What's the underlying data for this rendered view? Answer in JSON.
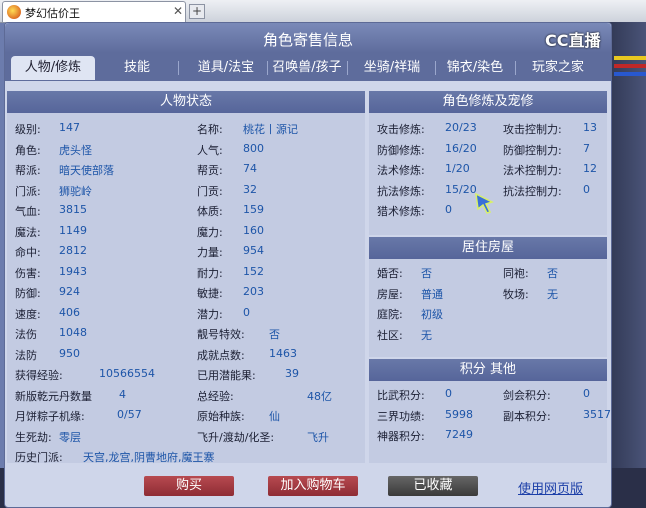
{
  "browser": {
    "tab_title": "梦幻估价王",
    "close_glyph": "✕",
    "new_tab_glyph": "+"
  },
  "panel": {
    "title": "角色寄售信息",
    "logo": "CC直播"
  },
  "tabs": [
    {
      "label": "人物/修炼"
    },
    {
      "label": "技能"
    },
    {
      "label": "道具/法宝"
    },
    {
      "label": "召唤兽/孩子"
    },
    {
      "label": "坐骑/祥瑞"
    },
    {
      "label": "锦衣/染色"
    },
    {
      "label": "玩家之家"
    }
  ],
  "status": {
    "title": "人物状态",
    "left": [
      {
        "label": "级别:",
        "value": "147"
      },
      {
        "label": "角色:",
        "value": "虎头怪"
      },
      {
        "label": "帮派:",
        "value": "暗天使部落"
      },
      {
        "label": "门派:",
        "value": "狮驼岭"
      },
      {
        "label": "气血:",
        "value": "3815"
      },
      {
        "label": "魔法:",
        "value": "1149"
      },
      {
        "label": "命中:",
        "value": "2812"
      },
      {
        "label": "伤害:",
        "value": "1943"
      },
      {
        "label": "防御:",
        "value": "924"
      },
      {
        "label": "速度:",
        "value": "406"
      },
      {
        "label": "法伤",
        "value": "1048"
      },
      {
        "label": "法防",
        "value": "950"
      },
      {
        "label": "获得经验:",
        "value": "10566554"
      },
      {
        "label": "新版乾元丹数量",
        "value": "4"
      },
      {
        "label": "月饼粽子机缘:",
        "value": "0/57"
      },
      {
        "label": "生死劫:",
        "value": "零层"
      }
    ],
    "right": [
      {
        "label": "名称:",
        "value": "桃花丨源记"
      },
      {
        "label": "人气:",
        "value": "800"
      },
      {
        "label": "帮贡:",
        "value": "74"
      },
      {
        "label": "门贡:",
        "value": "32"
      },
      {
        "label": "体质:",
        "value": "159"
      },
      {
        "label": "魔力:",
        "value": "160"
      },
      {
        "label": "力量:",
        "value": "954"
      },
      {
        "label": "耐力:",
        "value": "152"
      },
      {
        "label": "敏捷:",
        "value": "203"
      },
      {
        "label": "潜力:",
        "value": "0"
      },
      {
        "label": "靓号特效:",
        "value": "否"
      },
      {
        "label": "成就点数:",
        "value": "1463"
      },
      {
        "label": "已用潜能果:",
        "value": "39"
      },
      {
        "label": "总经验:",
        "value": "48亿"
      },
      {
        "label": "原始种族:",
        "value": "仙"
      },
      {
        "label": "飞升/渡劫/化圣:",
        "value": "飞升"
      }
    ],
    "history": {
      "label": "历史门派:",
      "value": "天宫,龙宫,阴曹地府,魔王寨"
    }
  },
  "cultivation": {
    "title": "角色修炼及宠修",
    "rows": [
      {
        "l1": "攻击修炼:",
        "v1": "20/23",
        "l2": "攻击控制力:",
        "v2": "13"
      },
      {
        "l1": "防御修炼:",
        "v1": "16/20",
        "l2": "防御控制力:",
        "v2": "7"
      },
      {
        "l1": "法术修炼:",
        "v1": "1/20",
        "l2": "法术控制力:",
        "v2": "12"
      },
      {
        "l1": "抗法修炼:",
        "v1": "15/20",
        "l2": "抗法控制力:",
        "v2": "0"
      },
      {
        "l1": "猎术修炼:",
        "v1": "0",
        "l2": "",
        "v2": ""
      }
    ]
  },
  "housing": {
    "title": "居住房屋",
    "rows": [
      {
        "l1": "婚否:",
        "v1": "否",
        "l2": "同袍:",
        "v2": "否"
      },
      {
        "l1": "房屋:",
        "v1": "普通",
        "l2": "牧场:",
        "v2": "无"
      },
      {
        "l1": "庭院:",
        "v1": "初级",
        "l2": "",
        "v2": ""
      },
      {
        "l1": "社区:",
        "v1": "无",
        "l2": "",
        "v2": ""
      }
    ]
  },
  "points": {
    "title": "积分 其他",
    "rows": [
      {
        "l1": "比武积分:",
        "v1": "0",
        "l2": "剑会积分:",
        "v2": "0"
      },
      {
        "l1": "三界功绩:",
        "v1": "5998",
        "l2": "副本积分:",
        "v2": "3517"
      },
      {
        "l1": "神器积分:",
        "v1": "7249",
        "l2": "",
        "v2": ""
      }
    ]
  },
  "actions": {
    "buy": "购买",
    "add_cart": "加入购物车",
    "favorited": "已收藏",
    "web_version": "使用网页版"
  },
  "colors": {
    "header": "#5e6c9c",
    "value": "#1d55a8",
    "btn_red": "#a03a42"
  }
}
